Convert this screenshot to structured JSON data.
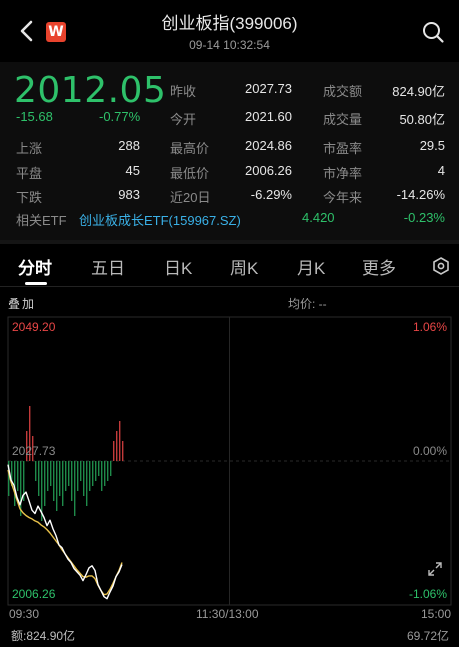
{
  "header": {
    "title": "创业板指(399006)",
    "datetime": "09-14 10:32:54",
    "logo_text": "W"
  },
  "quote": {
    "price": "2012.05",
    "change": "-15.68",
    "change_pct": "-0.77%",
    "rows": [
      {
        "l1": "上涨",
        "v1": "288",
        "l2": "昨收",
        "v2": "2027.73",
        "l3": "成交额",
        "v3": "824.90亿"
      },
      {
        "l1": "平盘",
        "v1": "45",
        "l2": "今开",
        "v2": "2021.60",
        "l3": "成交量",
        "v3": "50.80亿"
      },
      {
        "l1": "下跌",
        "v1": "983",
        "l2": "最高价",
        "v2": "2024.86",
        "l3": "市盈率",
        "v3": "29.5"
      },
      {
        "l1": "",
        "v1": "",
        "l2": "最低价",
        "v2": "2006.26",
        "l3": "市净率",
        "v3": "4"
      },
      {
        "l1": "",
        "v1": "",
        "l2": "近20日",
        "v2": "-6.29%",
        "l3": "今年来",
        "v3": "-14.26%"
      }
    ],
    "etf": {
      "label": "相关ETF",
      "name": "创业板成长ETF(159967.SZ)",
      "price": "4.420",
      "change_pct": "-0.23%"
    }
  },
  "tabs": [
    "分时",
    "五日",
    "日K",
    "周K",
    "月K",
    "更多"
  ],
  "active_tab": "分时",
  "chart_header": {
    "overlay": "叠加",
    "avg_price": "均价: --"
  },
  "chart_data": {
    "type": "line",
    "y_max_label": "2049.20",
    "y_mid_label": "2027.73",
    "y_min_label": "2006.26",
    "pct_max_label": "1.06%",
    "pct_mid_label": "0.00%",
    "pct_min_label": "-1.06%",
    "ylim": [
      2006.26,
      2049.2
    ],
    "x_ticks": [
      "09:30",
      "11:30/13:00",
      "15:00"
    ],
    "prev_close": 2027.73,
    "series": [
      {
        "name": "",
        "color": "#ffffff",
        "values": [
          2027.2,
          2024.9,
          2024.1,
          2022.3,
          2021.2,
          2022.6,
          2023.1,
          2021.8,
          2020.4,
          2019.9,
          2021.0,
          2020.2,
          2019.3,
          2018.1,
          2018.9,
          2017.6,
          2016.6,
          2015.2,
          2014.8,
          2013.9,
          2013.1,
          2012.6,
          2011.7,
          2011.2,
          2010.7,
          2009.9,
          2010.8,
          2011.8,
          2012.1,
          2011.4,
          2009.3,
          2008.4,
          2007.5,
          2007.2,
          2008.2,
          2009.1,
          2010.5,
          2011.2,
          2012.3
        ]
      },
      {
        "name": "",
        "color": "#e8c14a",
        "values": [
          2026.4,
          2024.6,
          2023.3,
          2021.9,
          2020.6,
          2020.0,
          2019.6,
          2019.3,
          2019.1,
          2018.8,
          2018.6,
          2018.2,
          2017.9,
          2017.5,
          2017.0,
          2016.4,
          2015.8,
          2015.2,
          2014.5,
          2013.9,
          2013.3,
          2012.7,
          2012.1,
          2011.5,
          2011.0,
          2010.5,
          2010.4,
          2010.6,
          2010.6,
          2010.2,
          2009.2,
          2008.4,
          2007.8,
          2007.9,
          2008.6,
          2009.5,
          2010.5,
          2011.4,
          2012.6
        ]
      }
    ],
    "volume_bars": [
      {
        "v": -0.35,
        "c": "g"
      },
      {
        "v": -0.25,
        "c": "g"
      },
      {
        "v": -0.45,
        "c": "g"
      },
      {
        "v": -0.3,
        "c": "g"
      },
      {
        "v": -0.55,
        "c": "g"
      },
      {
        "v": -0.4,
        "c": "g"
      },
      {
        "v": 0.3,
        "c": "r"
      },
      {
        "v": 0.55,
        "c": "r"
      },
      {
        "v": 0.25,
        "c": "r"
      },
      {
        "v": -0.2,
        "c": "g"
      },
      {
        "v": -0.35,
        "c": "g"
      },
      {
        "v": -0.6,
        "c": "g"
      },
      {
        "v": -0.45,
        "c": "g"
      },
      {
        "v": -0.3,
        "c": "g"
      },
      {
        "v": -0.25,
        "c": "g"
      },
      {
        "v": -0.4,
        "c": "g"
      },
      {
        "v": -0.5,
        "c": "g"
      },
      {
        "v": -0.35,
        "c": "g"
      },
      {
        "v": -0.45,
        "c": "g"
      },
      {
        "v": -0.3,
        "c": "g"
      },
      {
        "v": -0.25,
        "c": "g"
      },
      {
        "v": -0.4,
        "c": "g"
      },
      {
        "v": -0.55,
        "c": "g"
      },
      {
        "v": -0.3,
        "c": "g"
      },
      {
        "v": -0.2,
        "c": "g"
      },
      {
        "v": -0.35,
        "c": "g"
      },
      {
        "v": -0.45,
        "c": "g"
      },
      {
        "v": -0.3,
        "c": "g"
      },
      {
        "v": -0.25,
        "c": "g"
      },
      {
        "v": -0.2,
        "c": "g"
      },
      {
        "v": -0.15,
        "c": "g"
      },
      {
        "v": -0.3,
        "c": "g"
      },
      {
        "v": -0.25,
        "c": "g"
      },
      {
        "v": -0.2,
        "c": "g"
      },
      {
        "v": -0.15,
        "c": "g"
      },
      {
        "v": 0.2,
        "c": "r"
      },
      {
        "v": 0.3,
        "c": "r"
      },
      {
        "v": 0.4,
        "c": "r"
      },
      {
        "v": 0.2,
        "c": "r"
      }
    ],
    "grid": true
  },
  "footer": {
    "volume_label": "额:824.90亿",
    "volume_max": "69.72亿"
  },
  "colors": {
    "up": "#e84646",
    "down": "#2ec16a",
    "accent": "#3ab0e6"
  }
}
